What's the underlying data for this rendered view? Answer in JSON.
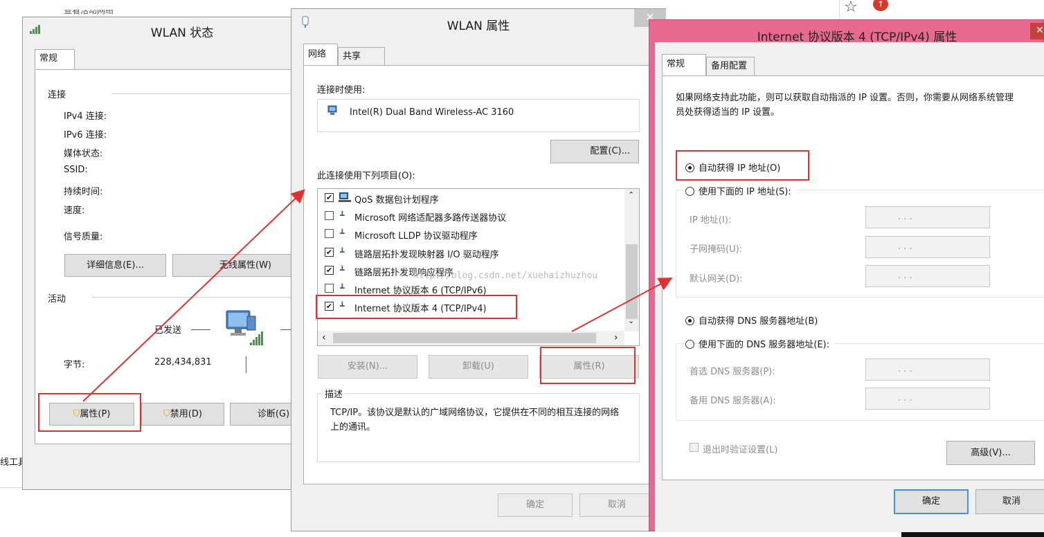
{
  "background": {
    "bottom_left_text": "线工具",
    "top_left_text": "查看活动网络"
  },
  "wlan_status": {
    "title": "WLAN 状态",
    "tab_general": "常规",
    "section_connection": "连接",
    "rows": [
      "IPv4 连接:",
      "IPv6 连接:",
      "媒体状态:",
      "SSID:",
      "持续时间:",
      "速度:"
    ],
    "signal_quality": "信号质量:",
    "details_button": "详细信息(E)...",
    "wireless_props_button": "无线属性(W)",
    "section_activity": "活动",
    "sent_label": "已发送",
    "bytes_label": "字节:",
    "bytes_sent": "228,434,831",
    "properties_button": "属性(P)",
    "disable_button": "禁用(D)",
    "diagnose_button": "诊断(G)"
  },
  "wlan_props": {
    "title": "WLAN 属性",
    "tab_network": "网络",
    "tab_sharing": "共享",
    "connect_using_label": "连接时使用:",
    "adapter_name": "Intel(R) Dual Band Wireless-AC 3160",
    "configure_button": "配置(C)...",
    "items_label": "此连接使用下列项目(O):",
    "items": [
      {
        "label": "QoS 数据包计划程序",
        "checked": true
      },
      {
        "label": "Microsoft 网络适配器多路传送器协议",
        "checked": false
      },
      {
        "label": "Microsoft LLDP 协议驱动程序",
        "checked": false
      },
      {
        "label": "链路层拓扑发现映射器 I/O 驱动程序",
        "checked": true
      },
      {
        "label": "链路层拓扑发现响应程序",
        "checked": true
      },
      {
        "label": "Internet 协议版本 6 (TCP/IPv6)",
        "checked": false
      },
      {
        "label": "Internet 协议版本 4 (TCP/IPv4)",
        "checked": true
      }
    ],
    "install_button": "安装(N)...",
    "uninstall_button": "卸载(U)",
    "properties_button": "属性(R)",
    "description_label": "描述",
    "description_text": "TCP/IP。该协议是默认的广域网络协议，它提供在不同的相互连接的网络上的通讯。",
    "ok_button": "确定",
    "cancel_button": "取消",
    "watermark": "http://blog.csdn.net/xuehaizhuzhou"
  },
  "ipv4_props": {
    "title": "Internet 协议版本 4 (TCP/IPv4) 属性",
    "tab_general": "常规",
    "tab_alternate": "备用配置",
    "intro_text": "如果网络支持此功能，则可以获取自动指派的 IP 设置。否则，你需要从网络系统管理员处获得适当的 IP 设置。",
    "auto_ip_label": "自动获得 IP 地址(O)",
    "manual_ip_label": "使用下面的 IP 地址(S):",
    "ip_address_label": "IP 地址(I):",
    "subnet_label": "子网掩码(U):",
    "gateway_label": "默认网关(D):",
    "auto_dns_label": "自动获得 DNS 服务器地址(B)",
    "manual_dns_label": "使用下面的 DNS 服务器地址(E):",
    "preferred_dns_label": "首选 DNS 服务器(P):",
    "alternate_dns_label": "备用 DNS 服务器(A):",
    "validate_label": "退出时验证设置(L)",
    "advanced_button": "高级(V)...",
    "ok_button": "确定",
    "cancel_button": "取消",
    "ip_placeholder": ".          .          ."
  },
  "colors": {
    "title_pink": "#e8698f",
    "annotation_red": "#e03030"
  }
}
